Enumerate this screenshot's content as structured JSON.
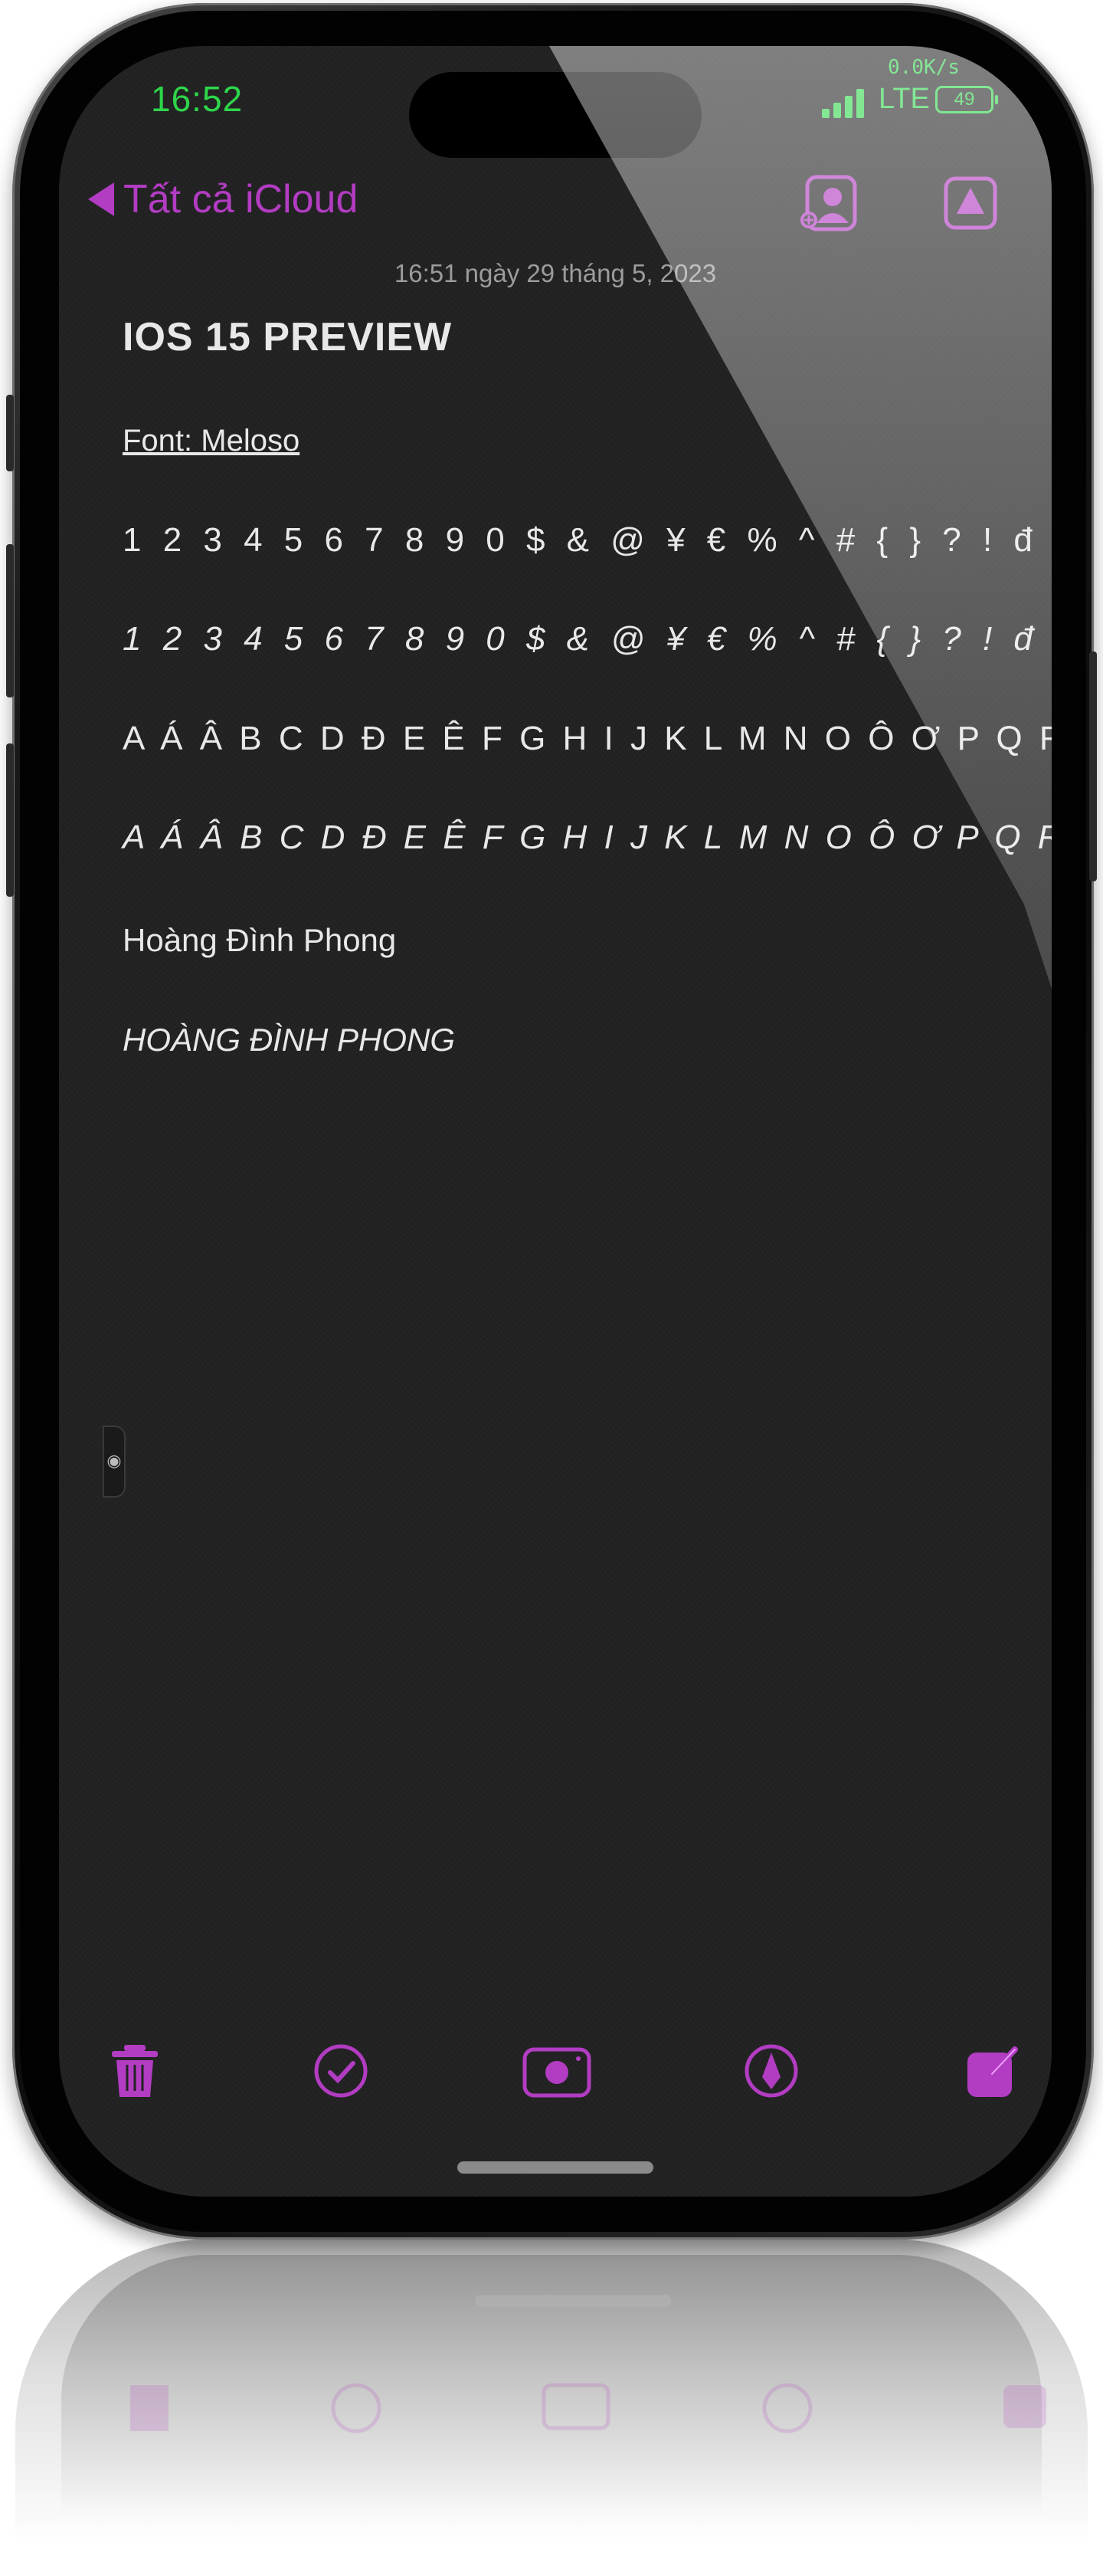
{
  "status_bar": {
    "time": "16:52",
    "net_speed": "0.0K/s",
    "network": "LTE",
    "battery": "49"
  },
  "nav": {
    "back_label": "Tất cả iCloud",
    "icons": [
      "share-person-icon",
      "navigate-icon"
    ]
  },
  "note": {
    "date": "16:51 ngày 29 tháng 5, 2023",
    "title": "IOS 15 PREVIEW",
    "font_label": "Font: Meloso",
    "charset_numbers": "1 2 3 4 5 6 7 8 9 0 $ & @ ¥ € % ^ # { } ? ! đ",
    "charset_numbers_italic": "1 2 3 4 5 6 7 8 9 0 $ & @ ¥ € % ^ # { } ? ! đ",
    "charset_letters": "A Á Â B C D Đ E Ê F G H I J K L M N O Ô Ơ P Q R S T U Ư V X Y Z",
    "charset_letters_italic": "A Á Â B C D Đ E Ê F G H I J K L M N O Ô Ơ P Q R S T U Ư V X Y Z",
    "name": "Hoàng Đình Phong",
    "name_italic": "HOÀNG ĐÌNH PHONG"
  },
  "toolbar": {
    "icons": [
      "trash-icon",
      "checklist-icon",
      "camera-icon",
      "markup-icon",
      "compose-icon"
    ]
  },
  "colors": {
    "accent": "#b23cc2",
    "status_green": "#2ed64a",
    "note_background": "#222223",
    "note_text": "#e8e8e8",
    "date_text": "#9c9c9c"
  }
}
